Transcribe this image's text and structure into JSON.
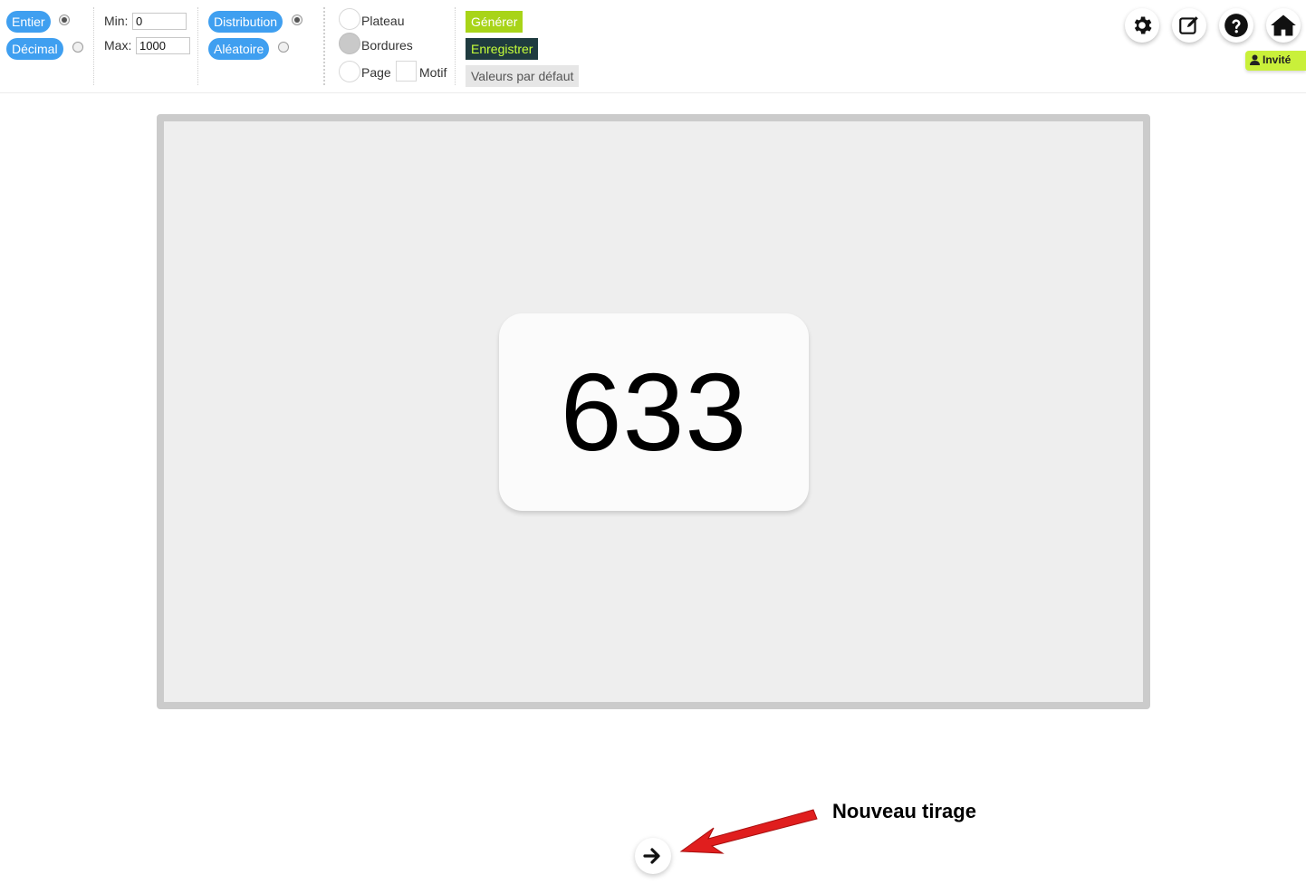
{
  "toolbar": {
    "type_options": [
      {
        "label": "Entier",
        "selected": true
      },
      {
        "label": "Décimal",
        "selected": false
      }
    ],
    "range": {
      "min_label": "Min:",
      "min_value": "0",
      "max_label": "Max:",
      "max_value": "1000"
    },
    "mode_options": [
      {
        "label": "Distribution",
        "selected": true
      },
      {
        "label": "Aléatoire",
        "selected": false
      }
    ],
    "display_options": {
      "plateau_label": "Plateau",
      "bordures_label": "Bordures",
      "page_label": "Page",
      "motif_label": "Motif"
    },
    "actions": {
      "generate_label": "Générer",
      "save_label": "Enregistrer",
      "defaults_label": "Valeurs par défaut"
    },
    "top_icons": [
      "gear-icon",
      "edit-icon",
      "help-icon",
      "home-icon"
    ],
    "user_badge": "Invité"
  },
  "board": {
    "drawn_number": "633"
  },
  "annotation": {
    "text": "Nouveau tirage",
    "arrow_color": "#e01e1e"
  },
  "colors": {
    "pill_blue": "#3f9ff0",
    "generate_green": "#a8d418",
    "save_dark": "#1f3b3f",
    "guest_badge": "#c9f03a",
    "board_bg": "#eeeeee",
    "board_border": "#cbcbcb"
  }
}
